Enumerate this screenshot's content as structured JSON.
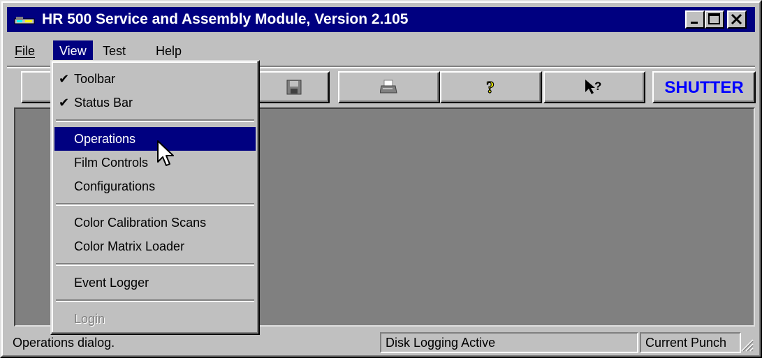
{
  "window": {
    "title": "HR 500 Service and Assembly Module, Version 2.105"
  },
  "menubar": {
    "items": [
      {
        "label": "File"
      },
      {
        "label": "View"
      },
      {
        "label": "Test"
      },
      {
        "label": "Help"
      }
    ]
  },
  "toolbar": {
    "shutter_label": "SHUTTER"
  },
  "view_menu": {
    "items": [
      {
        "label": "Toolbar",
        "checked": true
      },
      {
        "label": "Status Bar",
        "checked": true
      },
      {
        "label": "Operations",
        "highlighted": true
      },
      {
        "label": "Film Controls"
      },
      {
        "label": "Configurations"
      },
      {
        "label": "Color Calibration Scans"
      },
      {
        "label": "Color Matrix Loader"
      },
      {
        "label": "Event Logger"
      },
      {
        "label": "Login",
        "disabled": true
      }
    ],
    "check_mark": "✔"
  },
  "statusbar": {
    "message": "Operations dialog.",
    "disk_logging": "Disk Logging Active",
    "current_punch": "Current Punch"
  },
  "colors": {
    "title_bar": "#000080",
    "highlight": "#000080",
    "shutter_text": "#0000ff",
    "client_bg": "#808080"
  }
}
